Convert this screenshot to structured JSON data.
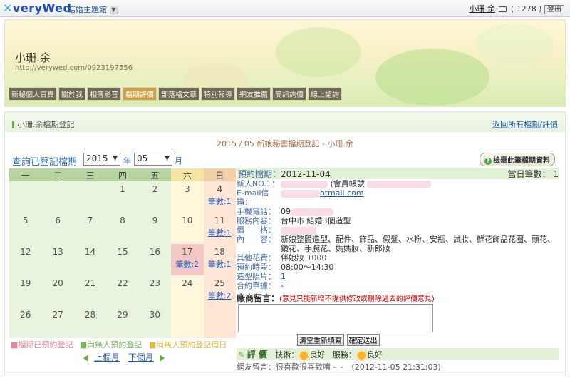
{
  "topbar": {
    "logo": "veryWed",
    "channel": "結婚主題館",
    "user_name": "小珊.余",
    "message_count": "( 1278 )",
    "logout": "登出"
  },
  "banner": {
    "blog_name": "小珊.余",
    "blog_url": "http://verywed.com/0923197556",
    "nav": [
      "新秘個人首頁",
      "關於我",
      "相簿影音",
      "檔期評價",
      "部落格文章",
      "特別報導",
      "網友推薦",
      "簡訊詢價",
      "線上諮詢"
    ],
    "active_nav": "檔期評價"
  },
  "section": {
    "title": "小珊.余檔期登記",
    "back_link": "返回所有檔期/評價",
    "caption": "2015 / 05 新娘秘書檔期登記 - 小珊.余",
    "query_label": "查詢已登記檔期",
    "year": "2015",
    "year_unit": "年",
    "month": "05",
    "month_unit": "月",
    "report_button": "檢舉此筆檔期資料"
  },
  "calendar": {
    "weekdays": [
      "一",
      "二",
      "三",
      "四",
      "五",
      "六",
      "日"
    ],
    "weeks": [
      [
        {
          "d": ""
        },
        {
          "d": ""
        },
        {
          "d": ""
        },
        {
          "d": "1"
        },
        {
          "d": "2"
        },
        {
          "d": "3"
        },
        {
          "d": "4",
          "c": "筆數:1"
        }
      ],
      [
        {
          "d": "5"
        },
        {
          "d": "6"
        },
        {
          "d": "7"
        },
        {
          "d": "8"
        },
        {
          "d": "9"
        },
        {
          "d": "10"
        },
        {
          "d": "11",
          "c": "筆數:1"
        }
      ],
      [
        {
          "d": "12"
        },
        {
          "d": "13"
        },
        {
          "d": "14"
        },
        {
          "d": "15"
        },
        {
          "d": "16"
        },
        {
          "d": "17",
          "c": "筆數:2"
        },
        {
          "d": "18",
          "c": "筆數:1"
        }
      ],
      [
        {
          "d": "19"
        },
        {
          "d": "20"
        },
        {
          "d": "21"
        },
        {
          "d": "22"
        },
        {
          "d": "23"
        },
        {
          "d": "24"
        },
        {
          "d": "25",
          "c": "筆數:2"
        }
      ],
      [
        {
          "d": "26"
        },
        {
          "d": "27"
        },
        {
          "d": "28"
        },
        {
          "d": "29"
        },
        {
          "d": "30"
        },
        {
          "d": ""
        },
        {
          "d": ""
        }
      ]
    ],
    "legend": [
      "■檔期已預約登記",
      "■尚無人預約登記",
      "■尚無人預約登記假日"
    ],
    "prev": "上個月",
    "next": "下個月"
  },
  "detail": {
    "booking_label": "預約檔期：",
    "booking_date": "2012-11-04",
    "daily_count": "當日筆數： 1",
    "bride_label": "新人NO.1：",
    "bride_suffix": "(會員帳號",
    "email_label": "E-mail信箱：",
    "email_tail": "otmail.com",
    "phone_label": "手機電話：",
    "phone_value": "09",
    "service_label": "服務內容：",
    "service_value": "台中市 結婚3個造型",
    "price_label": "價　　格：",
    "content_label": "內　　容：",
    "content_value": "新娘整體造型、配件、飾品、假髮、水粉、安瓶、試妝、鮮花飾品花圈、頭花、鑽花、手腕花、媽媽妝、新郎妝",
    "other_fee_label": "其他花費：",
    "other_fee_value": "伴娘妝 1000",
    "time_label": "預約時段：",
    "time_value": "08:00～14:30",
    "photo_label": "造型照片：",
    "photo_value": "1",
    "contract_label": "合約單據：",
    "contract_value": "-",
    "message_label": "廠商留言：",
    "message_note": "(意見只能新增不提供修改或刪除過去的評價意見)",
    "clear_button": "清空重新填寫",
    "submit_button": "確定送出",
    "eval_label": "評 價",
    "skill_label": "技術：",
    "skill_value": "良好",
    "service_rating_label": "服務：",
    "service_rating_value": "良好",
    "comment": "網友留言：很喜歡很喜歡唷~~　(2012-11-05 21:31:03)"
  }
}
